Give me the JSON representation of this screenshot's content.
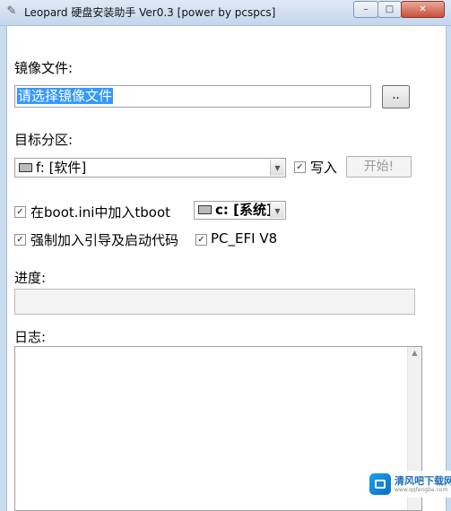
{
  "window": {
    "title": "Leopard 硬盘安装助手 Ver0.3 [power by pcspcs]",
    "icon": "app-icon",
    "min_label": "–",
    "max_label": "□",
    "close_label": "✕"
  },
  "image_file": {
    "label": "镜像文件:",
    "input_value": "请选择镜像文件",
    "browse_label": ".."
  },
  "target_partition": {
    "label": "目标分区:",
    "selected": "f: [软件]",
    "write_checked": true,
    "write_label": "写入",
    "start_label": "开始!"
  },
  "options": {
    "tboot_checked": true,
    "tboot_label": "在boot.ini中加入tboot",
    "tboot_drive": "c: [系统]",
    "force_boot_checked": true,
    "force_boot_label": "强制加入引导及启动代码",
    "pc_efi_checked": true,
    "pc_efi_label": "PC_EFI V8"
  },
  "progress": {
    "label": "进度:",
    "value": 0
  },
  "log": {
    "label": "日志:",
    "content": ""
  },
  "watermark": {
    "text": "清风吧下载网",
    "sub": "www.qqfengba.com"
  },
  "colors": {
    "selection": "#3399ff",
    "window_frame": "#c9dbee",
    "close_button": "#c8503a"
  }
}
